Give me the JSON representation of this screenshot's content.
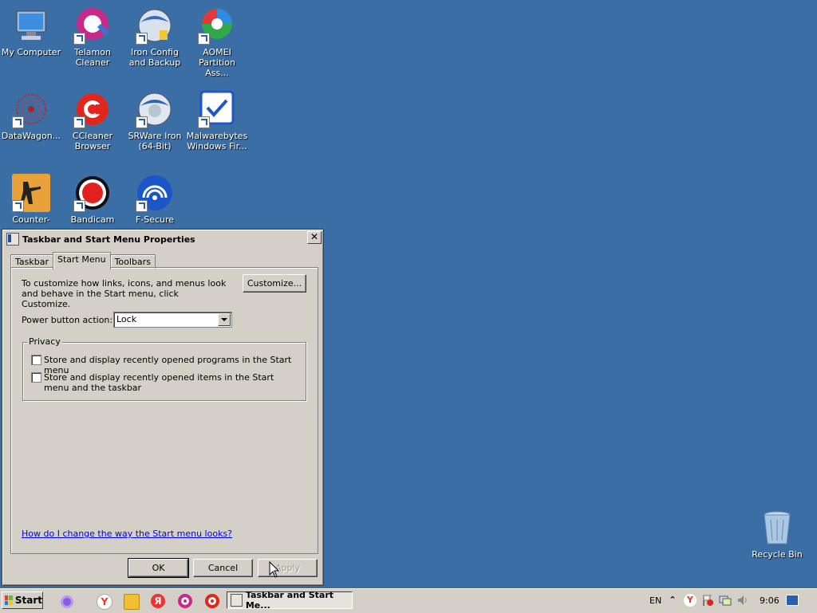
{
  "desktop": {
    "icons": [
      {
        "label": "My Computer"
      },
      {
        "label": "Telamon\nCleaner"
      },
      {
        "label": "Iron Config\nand Backup"
      },
      {
        "label": "AOMEI\nPartition Ass..."
      },
      {
        "label": "DataWagon..."
      },
      {
        "label": "CCleaner\nBrowser"
      },
      {
        "label": "SRWare Iron\n(64-Bit)"
      },
      {
        "label": "Malwarebytes\nWindows Fir..."
      },
      {
        "label": "Counter-Strike\nGlobal Off..."
      },
      {
        "label": "Bandicam"
      },
      {
        "label": "F-Secure\nFreedome VPN"
      },
      {
        "label": "Recycle Bin"
      }
    ]
  },
  "dialog": {
    "title": "Taskbar and Start Menu Properties",
    "close_glyph": "✕",
    "tabs": [
      "Taskbar",
      "Start Menu",
      "Toolbars"
    ],
    "active_tab": "Start Menu",
    "customize_text": "To customize how links, icons, and menus look and behave in the Start menu, click Customize.",
    "customize_button": "Customize...",
    "power_label": "Power button action:",
    "power_value": "Lock",
    "privacy_legend": "Privacy",
    "privacy_options": [
      {
        "label": "Store and display recently opened programs in the Start menu",
        "checked": false
      },
      {
        "label": "Store and display recently opened items in the Start menu and the taskbar",
        "checked": false
      }
    ],
    "help_link": "How do I change the way the Start menu looks?",
    "ok": "OK",
    "cancel": "Cancel",
    "apply": "Apply"
  },
  "taskbar": {
    "start_label": "Start",
    "task_button": "Taskbar and Start Me...",
    "language": "EN",
    "clock": "9:06"
  }
}
